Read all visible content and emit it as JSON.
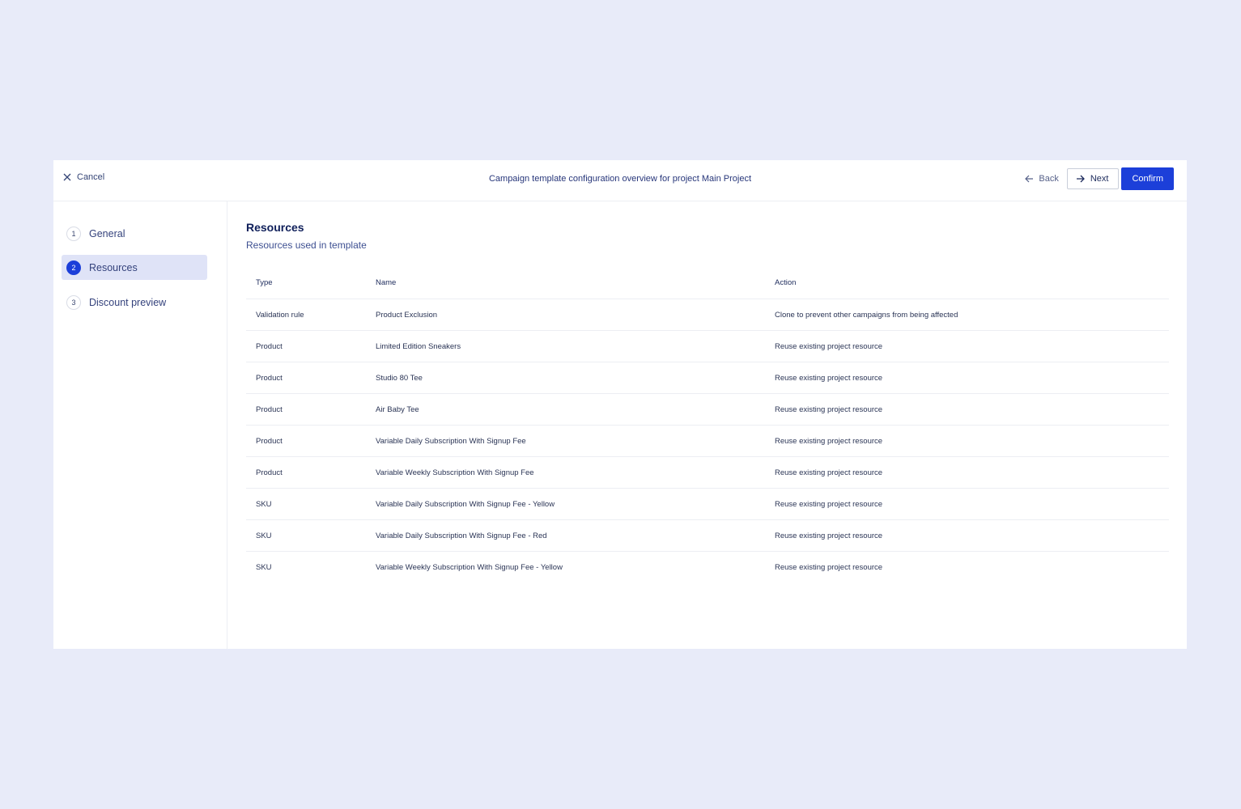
{
  "header": {
    "cancel_label": "Cancel",
    "title": "Campaign template configuration overview for project Main Project",
    "back_label": "Back",
    "next_label": "Next",
    "confirm_label": "Confirm"
  },
  "steps": [
    {
      "number": "1",
      "label": "General",
      "active": false
    },
    {
      "number": "2",
      "label": "Resources",
      "active": true
    },
    {
      "number": "3",
      "label": "Discount preview",
      "active": false
    }
  ],
  "section": {
    "title": "Resources",
    "subtitle": "Resources used in template"
  },
  "table": {
    "columns": [
      "Type",
      "Name",
      "Action"
    ],
    "rows": [
      [
        "Validation rule",
        "Product Exclusion",
        "Clone to prevent other campaigns from being affected"
      ],
      [
        "Product",
        "Limited Edition Sneakers",
        "Reuse existing project resource"
      ],
      [
        "Product",
        "Studio 80 Tee",
        "Reuse existing project resource"
      ],
      [
        "Product",
        "Air Baby Tee",
        "Reuse existing project resource"
      ],
      [
        "Product",
        "Variable Daily Subscription With Signup Fee",
        "Reuse existing project resource"
      ],
      [
        "Product",
        "Variable Weekly Subscription With Signup Fee",
        "Reuse existing project resource"
      ],
      [
        "SKU",
        "Variable Daily Subscription With Signup Fee - Yellow",
        "Reuse existing project resource"
      ],
      [
        "SKU",
        "Variable Daily Subscription With Signup Fee - Red",
        "Reuse existing project resource"
      ],
      [
        "SKU",
        "Variable Weekly Subscription With Signup Fee - Yellow",
        "Reuse existing project resource"
      ]
    ]
  },
  "icons": {
    "cancel": "close-icon",
    "back": "arrow-left-icon",
    "next": "arrow-right-icon"
  },
  "colors": {
    "background": "#e8ebf9",
    "accent": "#1c3fd9",
    "active_step_bg": "#dfe3f7"
  }
}
